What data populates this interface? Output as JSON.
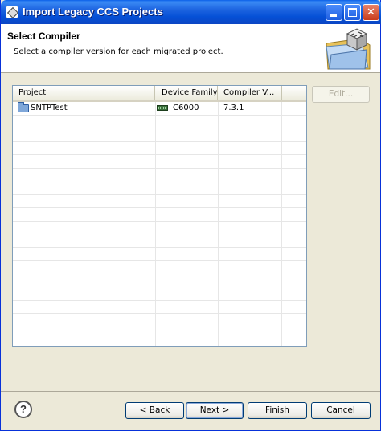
{
  "window": {
    "title": "Import Legacy CCS Projects"
  },
  "banner": {
    "heading": "Select Compiler",
    "description": "Select a compiler version for each migrated project."
  },
  "table": {
    "columns": [
      "Project",
      "Device Family",
      "Compiler V..."
    ],
    "rows": [
      {
        "project": "SNTPTest",
        "device_family": "C6000",
        "compiler_version": "7.3.1"
      }
    ]
  },
  "buttons": {
    "edit": "Edit...",
    "back": "< Back",
    "next": "Next >",
    "finish": "Finish",
    "cancel": "Cancel",
    "help": "?"
  },
  "colors": {
    "titlebar": "#0a5fe8",
    "window_bg": "#ece9d8",
    "table_border": "#7f9db9"
  },
  "icons": {
    "app": "app-icon",
    "wizard": "folder-cube-icon",
    "project": "folder-icon",
    "device": "chip-icon",
    "help": "help-icon"
  }
}
